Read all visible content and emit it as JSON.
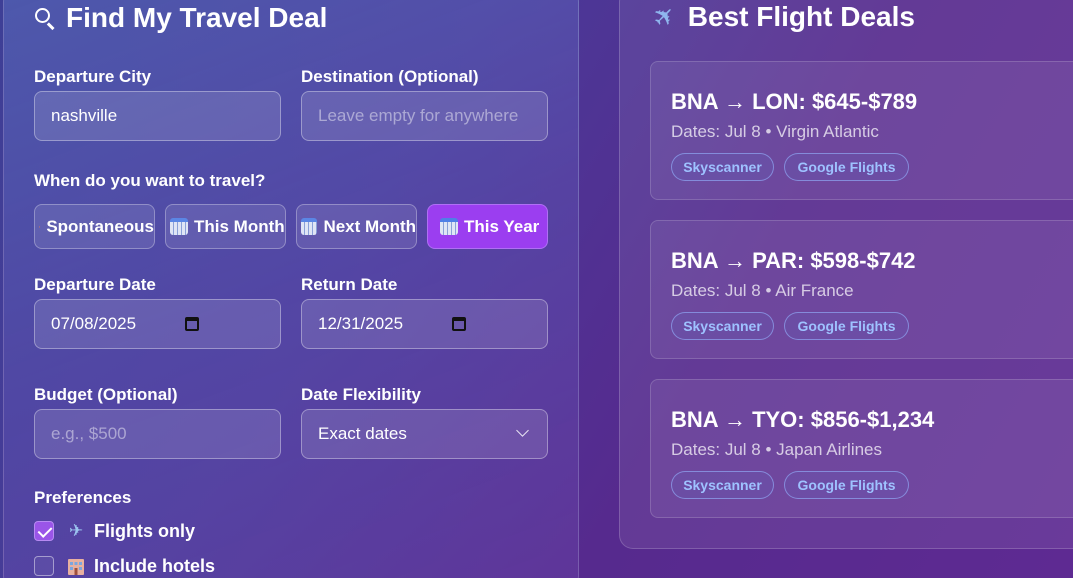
{
  "form": {
    "title": "Find My Travel Deal",
    "departure_label": "Departure City",
    "departure_value": "nashville",
    "destination_label": "Destination (Optional)",
    "destination_placeholder": "Leave empty for anywhere",
    "when_label": "When do you want to travel?",
    "timeframes": [
      {
        "label": "Spontaneous",
        "icon": "lightning-icon",
        "active": false
      },
      {
        "label": "This Month",
        "icon": "calendar-icon",
        "active": false
      },
      {
        "label": "Next Month",
        "icon": "calendar-icon",
        "active": false
      },
      {
        "label": "This Year",
        "icon": "calendar-icon",
        "active": true
      }
    ],
    "departure_date_label": "Departure Date",
    "departure_date_value": "07/08/2025",
    "return_date_label": "Return Date",
    "return_date_value": "12/31/2025",
    "budget_label": "Budget (Optional)",
    "budget_placeholder": "e.g., $500",
    "flexibility_label": "Date Flexibility",
    "flexibility_value": "Exact dates",
    "preferences_label": "Preferences",
    "preferences": [
      {
        "label": "Flights only",
        "icon": "airplane-icon",
        "checked": true
      },
      {
        "label": "Include hotels",
        "icon": "hotel-icon",
        "checked": false
      }
    ]
  },
  "deals": {
    "title": "Best Flight Deals",
    "items": [
      {
        "route": "BNA → LON: $645-$789",
        "meta": "Dates: Jul 8 • Virgin Atlantic",
        "link1": "Skyscanner",
        "link2": "Google Flights"
      },
      {
        "route": "BNA → PAR: $598-$742",
        "meta": "Dates: Jul 8 • Air France",
        "link1": "Skyscanner",
        "link2": "Google Flights"
      },
      {
        "route": "BNA → TYO: $856-$1,234",
        "meta": "Dates: Jul 8 • Japan Airlines",
        "link1": "Skyscanner",
        "link2": "Google Flights"
      }
    ]
  },
  "colors": {
    "accent": "#9b3ef0",
    "link": "#9ec2ff"
  }
}
